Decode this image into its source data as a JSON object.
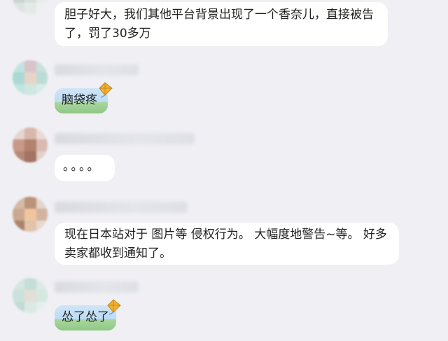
{
  "messages": [
    {
      "text": "胆子好大，我们其他平台背景出现了一个香奈儿，直接被告了，罚了30多万",
      "style": "white"
    },
    {
      "text": "脑袋疼",
      "style": "kite"
    },
    {
      "text": "。。。。",
      "style": "white"
    },
    {
      "text": "现在日本站对于 图片等 侵权行为。 大幅度地警告~等。  好多卖家都收到通知了。",
      "style": "white"
    },
    {
      "text": "怂了怂了",
      "style": "kite"
    }
  ],
  "icons": {
    "avatar": "avatar-blurred",
    "bubble_decoration": "kite-icon"
  },
  "colors": {
    "background": "#efeff4",
    "bubble": "#ffffff",
    "kite_bubble_sky": "#cfe5f7",
    "kite_bubble_grass": "#8fc884"
  }
}
